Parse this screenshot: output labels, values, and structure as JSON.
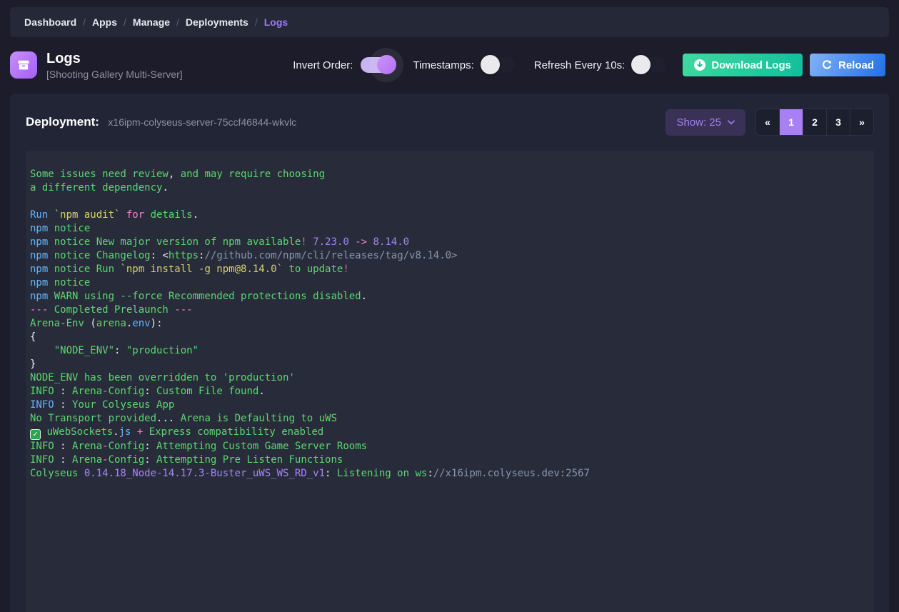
{
  "breadcrumb": {
    "separator": "/",
    "items": [
      {
        "label": "Dashboard",
        "active": false
      },
      {
        "label": "Apps",
        "active": false
      },
      {
        "label": "Manage",
        "active": false
      },
      {
        "label": "Deployments",
        "active": false
      },
      {
        "label": "Logs",
        "active": true
      }
    ]
  },
  "header": {
    "title": "Logs",
    "subtitle": "[Shooting Gallery Multi-Server]",
    "icon": "archive-icon"
  },
  "controls": {
    "toggles": [
      {
        "label": "Invert Order:",
        "on": true
      },
      {
        "label": "Timestamps:",
        "on": false
      },
      {
        "label": "Refresh Every 10s:",
        "on": false
      }
    ],
    "buttons": {
      "download": {
        "label": "Download Logs",
        "icon": "download-circle-icon",
        "color": "#12c094"
      },
      "reload": {
        "label": "Reload",
        "icon": "refresh-icon",
        "color": "#2a72e8"
      }
    }
  },
  "toolbar": {
    "deployment_label": "Deployment:",
    "deployment_value": "x16ipm-colyseus-server-75ccf46844-wkvlc",
    "show_label": "Show: 25",
    "show_icon": "chevron-down-icon",
    "pagination": {
      "items": [
        {
          "label": "«",
          "active": false
        },
        {
          "label": "1",
          "active": true
        },
        {
          "label": "2",
          "active": false
        },
        {
          "label": "3",
          "active": false
        },
        {
          "label": "»",
          "active": false
        }
      ]
    }
  },
  "theme": {
    "page_bg": "#1d1c2a",
    "bar_bg": "#242837",
    "card_bg": "#212536",
    "log_bg": "#282c3a",
    "accent_purple": "#a97ff5"
  },
  "log": {
    "palette": {
      "g": "#5cd671",
      "b": "#63b4ff",
      "y": "#d6d06e",
      "p": "#f77fcb",
      "r": "#ef5f88",
      "u": "#a385f2",
      "w": "#e9ebf2",
      "c": "#8795ae",
      "check_bg": "#2da44e"
    },
    "lines": [
      [
        [
          "g",
          "Some issues need review"
        ],
        [
          "w",
          ","
        ],
        [
          "g",
          " and may require choosing"
        ]
      ],
      [
        [
          "g",
          "a different dependency"
        ],
        [
          "w",
          "."
        ]
      ],
      [],
      [
        [
          "b",
          "Run "
        ],
        [
          "y",
          "`npm audit` "
        ],
        [
          "p",
          "for "
        ],
        [
          "g",
          "details"
        ],
        [
          "w",
          "."
        ]
      ],
      [
        [
          "b",
          "npm "
        ],
        [
          "g",
          "notice"
        ]
      ],
      [
        [
          "b",
          "npm "
        ],
        [
          "g",
          "notice New major version of npm available"
        ],
        [
          "r",
          "!"
        ],
        [
          "g",
          " "
        ],
        [
          "u",
          "7.23.0"
        ],
        [
          "g",
          " "
        ],
        [
          "p",
          "->"
        ],
        [
          "g",
          " "
        ],
        [
          "u",
          "8.14.0"
        ]
      ],
      [
        [
          "b",
          "npm "
        ],
        [
          "g",
          "notice Changelog"
        ],
        [
          "w",
          ": <"
        ],
        [
          "g",
          "https"
        ],
        [
          "w",
          ":"
        ],
        [
          "c",
          "//github.com/npm/cli/releases/tag/v8.14.0>"
        ]
      ],
      [
        [
          "b",
          "npm "
        ],
        [
          "g",
          "notice Run "
        ],
        [
          "y",
          "`npm install -g npm@8.14.0` "
        ],
        [
          "g",
          "to update"
        ],
        [
          "r",
          "!"
        ]
      ],
      [
        [
          "b",
          "npm "
        ],
        [
          "g",
          "notice"
        ]
      ],
      [
        [
          "b",
          "npm "
        ],
        [
          "g",
          "WARN using --force Recommended protections disabled"
        ],
        [
          "w",
          "."
        ]
      ],
      [
        [
          "p",
          "--- "
        ],
        [
          "g",
          "Completed Prelaunch "
        ],
        [
          "p",
          "---"
        ]
      ],
      [
        [
          "g",
          "Arena"
        ],
        [
          "p",
          "-"
        ],
        [
          "g",
          "Env "
        ],
        [
          "w",
          "("
        ],
        [
          "g",
          "arena"
        ],
        [
          "w",
          "."
        ],
        [
          "b",
          "env"
        ],
        [
          "w",
          "):"
        ]
      ],
      [
        [
          "w",
          "{"
        ]
      ],
      [
        [
          "w",
          "    "
        ],
        [
          "g",
          "\"NODE_ENV\""
        ],
        [
          "w",
          ": "
        ],
        [
          "g",
          "\"production\""
        ]
      ],
      [
        [
          "w",
          "}"
        ]
      ],
      [
        [
          "g",
          "NODE_ENV has been overridden to 'production'"
        ]
      ],
      [
        [
          "g",
          "INFO "
        ],
        [
          "w",
          ": "
        ],
        [
          "g",
          "Arena"
        ],
        [
          "p",
          "-"
        ],
        [
          "g",
          "Config"
        ],
        [
          "w",
          ": "
        ],
        [
          "g",
          "Custom File found"
        ],
        [
          "w",
          "."
        ]
      ],
      [
        [
          "b",
          "INFO "
        ],
        [
          "w",
          ": "
        ],
        [
          "g",
          "Your Colyseus App"
        ]
      ],
      [
        [
          "g",
          "No Transport provided"
        ],
        [
          "w",
          "..."
        ],
        [
          "g",
          " Arena is Defaulting to uWS"
        ]
      ],
      [
        [
          "check",
          "✓"
        ],
        [
          "w",
          " "
        ],
        [
          "g",
          "uWebSockets"
        ],
        [
          "w",
          "."
        ],
        [
          "b",
          "js"
        ],
        [
          "g",
          " "
        ],
        [
          "p",
          "+"
        ],
        [
          "g",
          " Express compatibility enabled"
        ]
      ],
      [
        [
          "g",
          "INFO "
        ],
        [
          "w",
          ": "
        ],
        [
          "g",
          "Arena"
        ],
        [
          "p",
          "-"
        ],
        [
          "g",
          "Config"
        ],
        [
          "w",
          ": "
        ],
        [
          "g",
          "Attempting Custom Game Server Rooms"
        ]
      ],
      [
        [
          "g",
          "INFO "
        ],
        [
          "w",
          ": "
        ],
        [
          "g",
          "Arena"
        ],
        [
          "p",
          "-"
        ],
        [
          "g",
          "Config"
        ],
        [
          "w",
          ": "
        ],
        [
          "g",
          "Attempting Pre Listen Functions"
        ]
      ],
      [
        [
          "g",
          "Colyseus "
        ],
        [
          "u",
          "0.14.18_Node-14.17.3-Buster_uWS_WS_RD_v1"
        ],
        [
          "w",
          ": "
        ],
        [
          "g",
          "Listening on ws"
        ],
        [
          "w",
          ":"
        ],
        [
          "c",
          "//x16ipm.colyseus.dev:2567"
        ]
      ]
    ]
  }
}
